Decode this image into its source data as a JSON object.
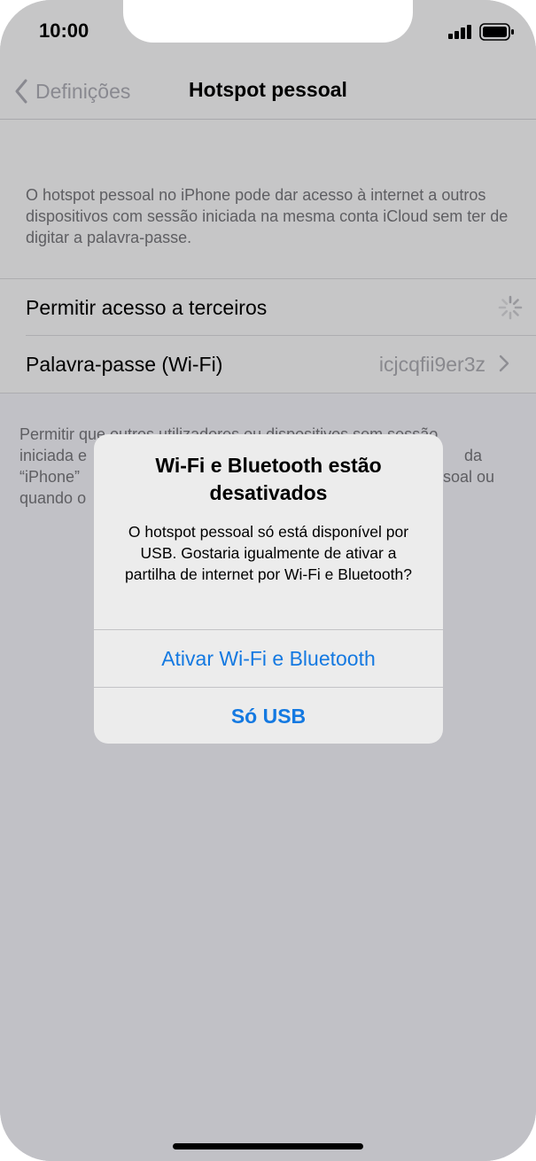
{
  "status_bar": {
    "time": "10:00"
  },
  "nav": {
    "back_label": "Definições",
    "title": "Hotspot pessoal"
  },
  "description": "O hotspot pessoal no iPhone pode dar acesso à internet a outros dispositivos com sessão iniciada na mesma conta iCloud sem ter de digitar a palavra-passe.",
  "settings": {
    "allow_others_label": "Permitir acesso a terceiros",
    "password_label": "Palavra-passe (Wi-Fi)",
    "password_value": "icjcqfii9er3z"
  },
  "footer": {
    "line1": "Permitir que outros utilizadores ou dispositivos sem sessão",
    "line2": "iniciada e",
    "line2_right": "da",
    "line3": "“iPhone”",
    "line3_right": "soal ou",
    "line4": "quando o"
  },
  "alert": {
    "title": "Wi-Fi e Bluetooth estão desativados",
    "message": "O hotspot pessoal só está disponível por USB. Gostaria igualmente de ativar a partilha de internet por Wi-Fi e Bluetooth?",
    "primary_button": "Ativar Wi-Fi e Bluetooth",
    "secondary_button": "Só USB"
  },
  "colors": {
    "accent": "#1479e1",
    "dim_background": "#c1c1c6"
  }
}
